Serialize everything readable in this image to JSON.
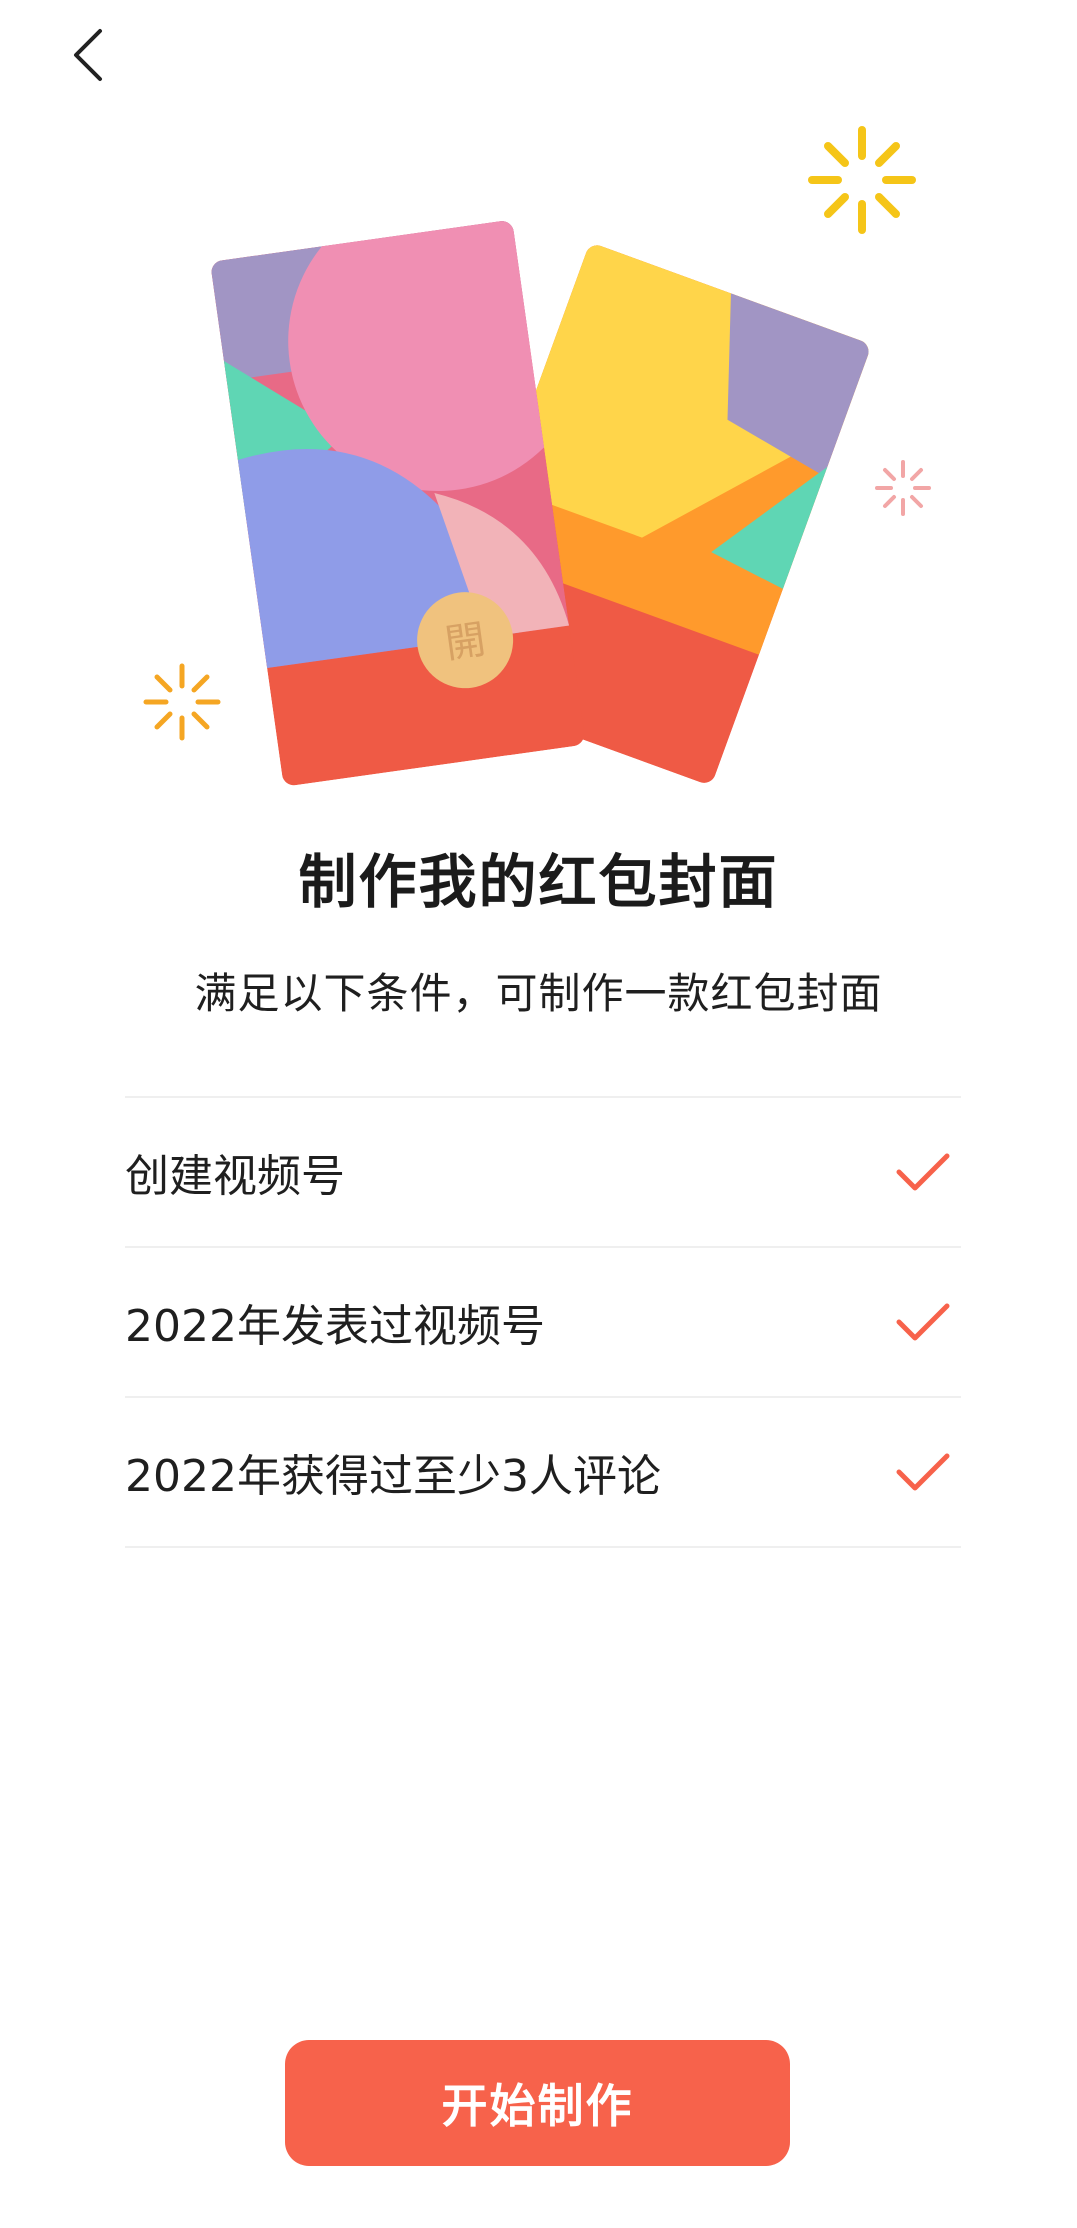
{
  "nav": {
    "back_icon": "chevron-left-icon"
  },
  "hero": {
    "left_card_seal": "開",
    "right_card_seal": "開",
    "colors": {
      "red": "#ef5a45",
      "pink": "#f08fb3",
      "purple": "#a195c4",
      "blue": "#8f9ce8",
      "teal": "#5fd6b4",
      "yellow": "#ffd54a",
      "orange": "#ff9a2c",
      "seal": "#f0c27e",
      "sparkle_yellow": "#f5c518",
      "sparkle_pink": "#f2a6a6",
      "sparkle_orange": "#f5a623"
    }
  },
  "title": "制作我的红包封面",
  "subtitle": "满足以下条件，可制作一款红包封面",
  "conditions": [
    {
      "label": "创建视频号",
      "met": true,
      "icon": "checkmark-icon"
    },
    {
      "label": "2022年发表过视频号",
      "met": true,
      "icon": "checkmark-icon"
    },
    {
      "label": "2022年获得过至少3人评论",
      "met": true,
      "icon": "checkmark-icon"
    }
  ],
  "accent_color": "#f7624b",
  "start_button_label": "开始制作"
}
